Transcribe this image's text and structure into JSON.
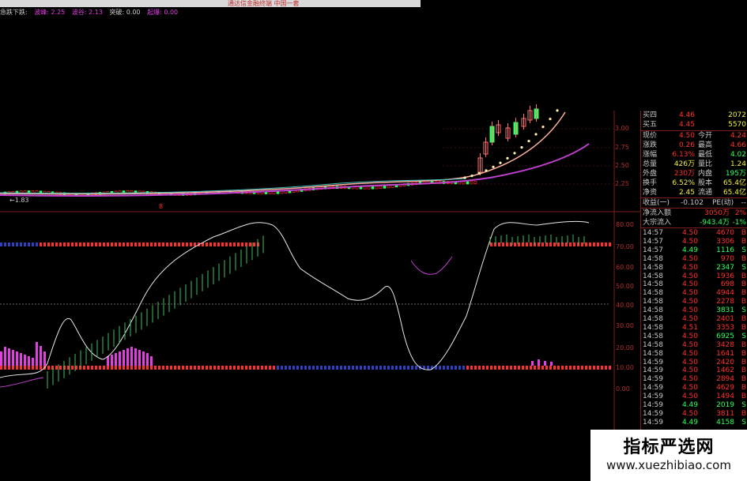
{
  "header": {
    "window_title": "通达信金融终端 中国一套",
    "indicator_name": "急跌下跌:",
    "labels": [
      {
        "text": "波峰: 2.25",
        "color": "#e040e0"
      },
      {
        "text": "波谷: 2.13",
        "color": "#e040e0"
      },
      {
        "text": "突破: 0.00",
        "color": "#d0d0d0"
      },
      {
        "text": "起爆: 0.00",
        "color": "#e040e0"
      }
    ]
  },
  "price_axis": [
    "3.00",
    "2.75",
    "2.50",
    "2.25"
  ],
  "low_marker": "←1.83",
  "marker_8": "8",
  "osc_axis": [
    "80.00",
    "70.00",
    "60.00",
    "50.00",
    "40.00",
    "30.00",
    "20.00",
    "10.00",
    "0.00"
  ],
  "quote": {
    "bid_rows": [
      {
        "label": "买四",
        "price": "4.46",
        "vol": "2072"
      },
      {
        "label": "买五",
        "price": "4.45",
        "vol": "5570"
      }
    ],
    "stats": [
      {
        "l1": "现价",
        "v1": "4.50",
        "l2": "今开",
        "v2": "4.24"
      },
      {
        "l1": "涨跌",
        "v1": "0.26",
        "l2": "最高",
        "v2": "4.66"
      },
      {
        "l1": "涨幅",
        "v1": "6.13%",
        "l2": "最低",
        "v2": "4.02"
      },
      {
        "l1": "总量",
        "v1": "426万",
        "l2": "量比",
        "v2": "1.24"
      },
      {
        "l1": "外盘",
        "v1": "230万",
        "l2": "内盘",
        "v2": "195万"
      },
      {
        "l1": "换手",
        "v1": "6.52%",
        "l2": "股本",
        "v2": "65.4亿"
      },
      {
        "l1": "净资",
        "v1": "2.45",
        "l2": "流通",
        "v2": "65.4亿"
      }
    ],
    "earnings": {
      "label": "收益(一)",
      "value": "-0.102",
      "pe_label": "PE(动)",
      "pe_value": "--"
    },
    "flows": [
      {
        "label": "净流入额",
        "value": "3050万",
        "pct": "2%"
      },
      {
        "label": "大宗流入",
        "value": "-943.4万",
        "pct": "-1%"
      }
    ],
    "ticks": [
      {
        "t": "14:57",
        "p": "4.50",
        "v": "4670",
        "s": "B"
      },
      {
        "t": "14:57",
        "p": "4.50",
        "v": "3306",
        "s": "B"
      },
      {
        "t": "14:57",
        "p": "4.49",
        "v": "1116",
        "s": "S"
      },
      {
        "t": "14:58",
        "p": "4.50",
        "v": "970",
        "s": "B"
      },
      {
        "t": "14:58",
        "p": "4.50",
        "v": "2347",
        "s": "S"
      },
      {
        "t": "14:58",
        "p": "4.50",
        "v": "1936",
        "s": "B"
      },
      {
        "t": "14:58",
        "p": "4.50",
        "v": "698",
        "s": "B"
      },
      {
        "t": "14:58",
        "p": "4.50",
        "v": "4944",
        "s": "B"
      },
      {
        "t": "14:58",
        "p": "4.50",
        "v": "2278",
        "s": "B"
      },
      {
        "t": "14:58",
        "p": "4.50",
        "v": "3831",
        "s": "S"
      },
      {
        "t": "14:58",
        "p": "4.50",
        "v": "2401",
        "s": "B"
      },
      {
        "t": "14:58",
        "p": "4.51",
        "v": "3353",
        "s": "B"
      },
      {
        "t": "14:58",
        "p": "4.50",
        "v": "6925",
        "s": "S"
      },
      {
        "t": "14:58",
        "p": "4.50",
        "v": "3428",
        "s": "B"
      },
      {
        "t": "14:58",
        "p": "4.50",
        "v": "1641",
        "s": "B"
      },
      {
        "t": "14:59",
        "p": "4.50",
        "v": "2420",
        "s": "B"
      },
      {
        "t": "14:59",
        "p": "4.50",
        "v": "1462",
        "s": "B"
      },
      {
        "t": "14:59",
        "p": "4.50",
        "v": "2894",
        "s": "B"
      },
      {
        "t": "14:59",
        "p": "4.50",
        "v": "4629",
        "s": "B"
      },
      {
        "t": "14:59",
        "p": "4.50",
        "v": "1494",
        "s": "B"
      },
      {
        "t": "14:59",
        "p": "4.49",
        "v": "2019",
        "s": "S"
      },
      {
        "t": "14:59",
        "p": "4.50",
        "v": "3811",
        "s": "B"
      },
      {
        "t": "14:59",
        "p": "4.49",
        "v": "4158",
        "s": "S"
      }
    ]
  },
  "watermark": {
    "title": "指标严选网",
    "url": "www.xuezhibiao.com"
  },
  "colors": {
    "up": "#ff3030",
    "down": "#30ff60",
    "magenta": "#e040e0",
    "yellow": "#f0f040",
    "grid": "#7a1e1e",
    "white_line": "#e8e8e8",
    "ma_pink": "#ffb0b0"
  }
}
